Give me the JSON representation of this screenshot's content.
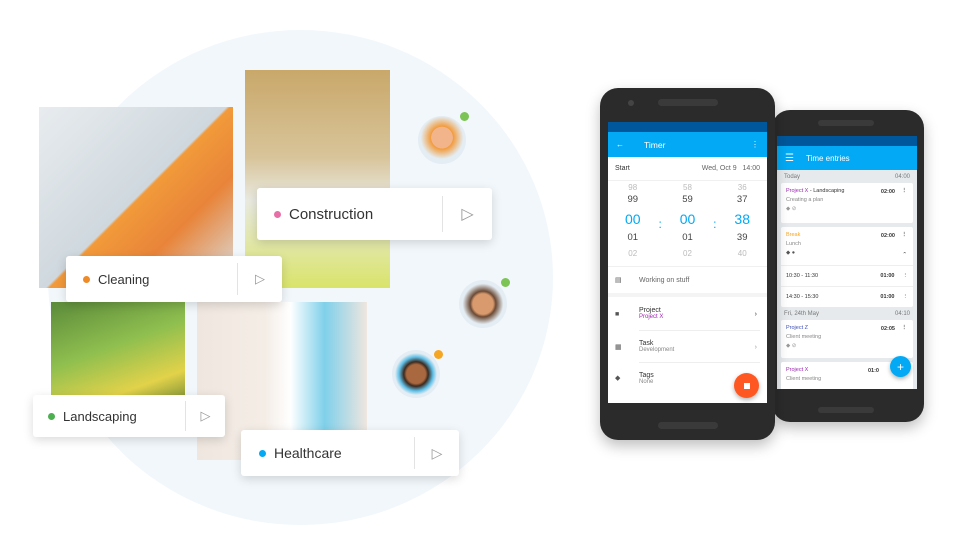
{
  "categories": [
    {
      "label": "Cleaning",
      "dot": "#f08a24"
    },
    {
      "label": "Construction",
      "dot": "#e86ea8"
    },
    {
      "label": "Landscaping",
      "dot": "#4caf50"
    },
    {
      "label": "Healthcare",
      "dot": "#03a9f4"
    }
  ],
  "status_colors": {
    "online": "#7cc454",
    "away": "#f5a623"
  },
  "timer": {
    "title": "Timer",
    "start_label": "Start",
    "date": "Wed, Oct 9",
    "time": "14:00",
    "hours": [
      "98",
      "99",
      "00",
      "01",
      "02"
    ],
    "minutes": [
      "58",
      "59",
      "00",
      "01",
      "02"
    ],
    "seconds": [
      "36",
      "37",
      "38",
      "39",
      "40"
    ],
    "separator": ":",
    "description": "Working on stuff",
    "project_label": "Project",
    "project_value": "Project X",
    "task_label": "Task",
    "task_value": "Development",
    "tags_label": "Tags",
    "tags_value": "None"
  },
  "entries": {
    "title": "Time entries",
    "groups": [
      {
        "date": "Today",
        "total": "04:00"
      },
      {
        "date": "Fri, 24th May",
        "total": "04:10"
      }
    ],
    "e1": {
      "project": "Project X",
      "sep": " - ",
      "task": "Landscaping",
      "desc": "Creating a plan",
      "dur": "02:00"
    },
    "e2": {
      "project": "Break",
      "desc": "Lunch",
      "dur": "02:00",
      "sub": [
        {
          "range": "10:30 - 11:30",
          "dur": "01:00"
        },
        {
          "range": "14:30 - 15:30",
          "dur": "01:00"
        }
      ]
    },
    "e3": {
      "project": "Project Z",
      "desc": "Client meeting",
      "dur": "02:05"
    },
    "e4": {
      "project": "Project X",
      "desc": "Client meeting",
      "dur": "01:0"
    }
  }
}
